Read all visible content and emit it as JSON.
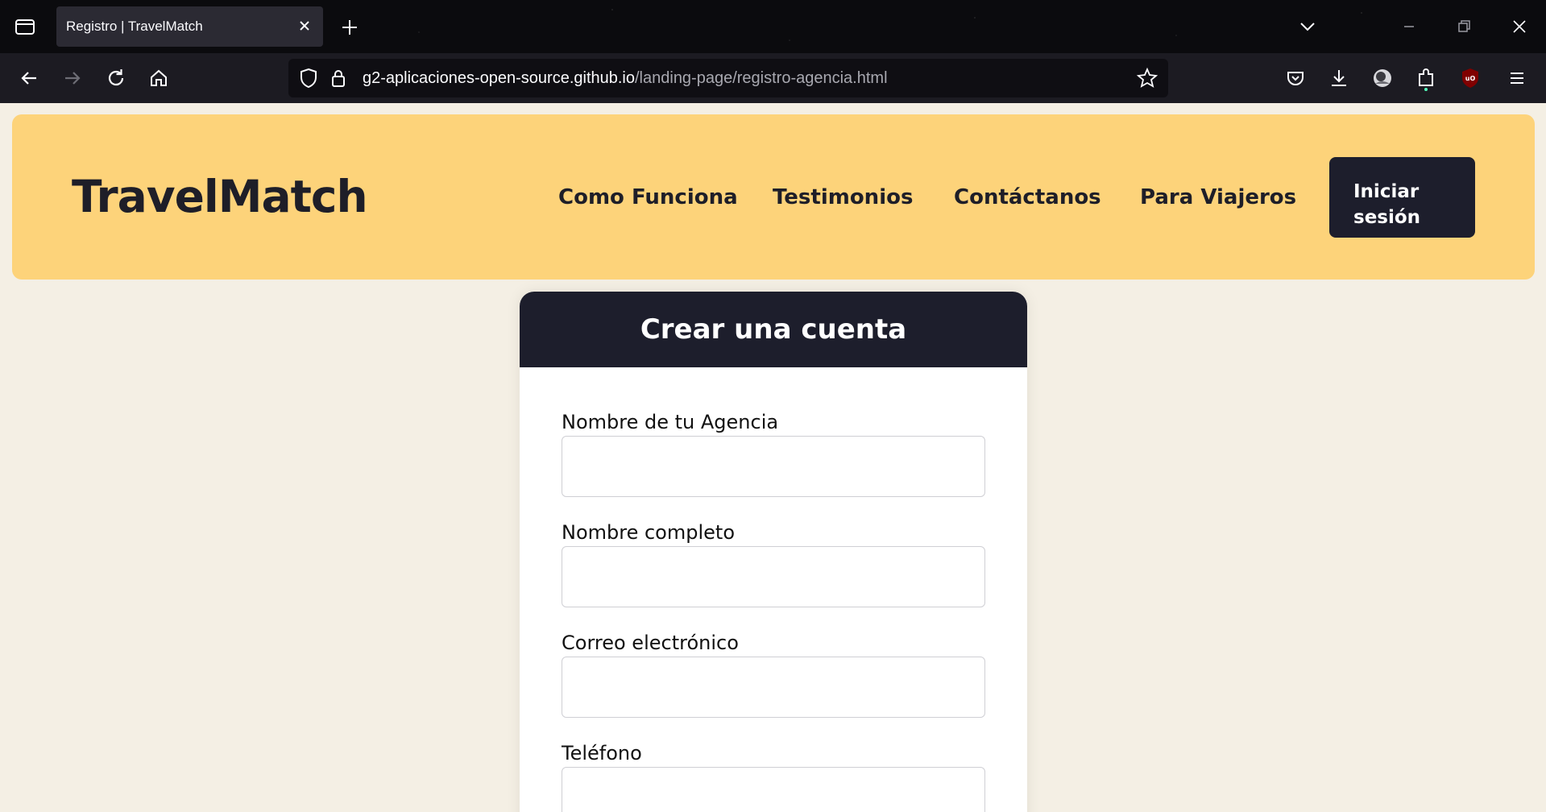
{
  "browser": {
    "tab": {
      "title": "Registro | TravelMatch"
    },
    "url": {
      "host": "g2-aplicaciones-open-source.github.io",
      "path": "/landing-page/registro-agencia.html"
    }
  },
  "header": {
    "brand": "TravelMatch",
    "nav": [
      {
        "label": "Como Funciona"
      },
      {
        "label": "Testimonios"
      },
      {
        "label": "Contáctanos"
      },
      {
        "label": "Para Viajeros"
      }
    ],
    "login_line1": "Iniciar",
    "login_line2": "sesión"
  },
  "form": {
    "title": "Crear una cuenta",
    "fields": [
      {
        "label": "Nombre de tu Agencia",
        "value": ""
      },
      {
        "label": "Nombre completo",
        "value": ""
      },
      {
        "label": "Correo electrónico",
        "value": ""
      },
      {
        "label": "Teléfono",
        "value": ""
      }
    ]
  },
  "colors": {
    "header_bg": "#fdd37a",
    "dark": "#1d1e2c",
    "page_bg": "#f4efe4"
  }
}
